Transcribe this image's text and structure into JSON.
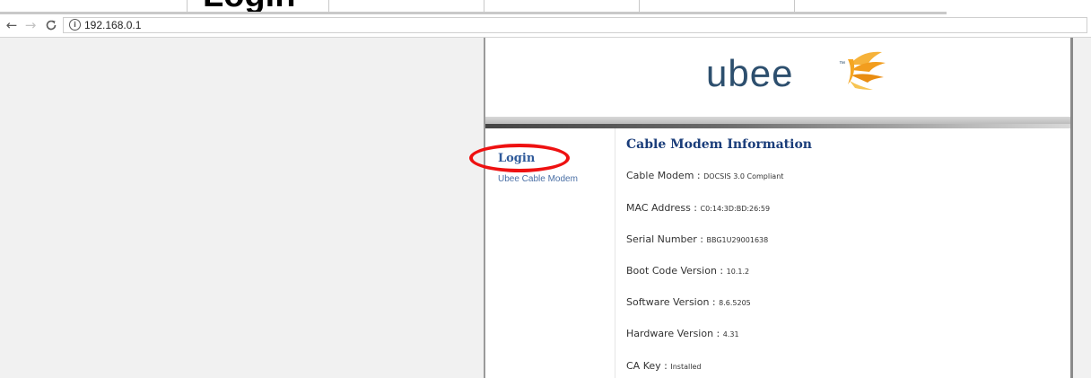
{
  "page": {
    "cropped_heading": "Login"
  },
  "browser": {
    "address": "192.168.0.1",
    "back_icon": "back-arrow-icon",
    "forward_icon": "forward-arrow-icon",
    "reload_icon": "reload-icon",
    "info_icon": "info-icon"
  },
  "router": {
    "logo_text": "ubee",
    "logo_tm": "™",
    "menu": {
      "login": "Login",
      "cable_modem": "Ubee Cable Modem"
    },
    "info": {
      "title": "Cable Modem Information",
      "rows": [
        {
          "label": "Cable Modem",
          "value": "DOCSIS 3.0 Compliant"
        },
        {
          "label": "MAC Address",
          "value": "C0:14:3D:BD:26:59"
        },
        {
          "label": "Serial Number",
          "value": "BBG1U29001638"
        },
        {
          "label": "Boot Code Version",
          "value": "10.1.2"
        },
        {
          "label": "Software Version",
          "value": "8.6.5205"
        },
        {
          "label": "Hardware Version",
          "value": "4.31"
        },
        {
          "label": "CA Key",
          "value": "Installed"
        }
      ]
    }
  },
  "colors": {
    "annotation_circle": "#ee1111",
    "title_blue": "#1a3d7a",
    "link_blue": "#2f5a9a",
    "logo_navy": "#2d4f6e",
    "logo_orange": "#f5a623"
  }
}
